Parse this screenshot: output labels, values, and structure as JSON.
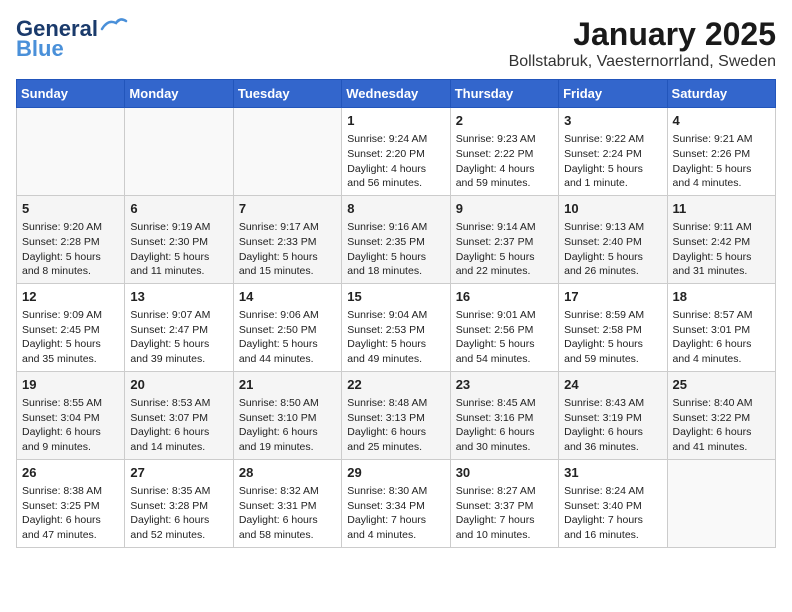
{
  "header": {
    "logo_line1": "General",
    "logo_line2": "Blue",
    "title": "January 2025",
    "subtitle": "Bollstabruk, Vaesternorrland, Sweden"
  },
  "days_of_week": [
    "Sunday",
    "Monday",
    "Tuesday",
    "Wednesday",
    "Thursday",
    "Friday",
    "Saturday"
  ],
  "weeks": [
    [
      {
        "day": "",
        "info": ""
      },
      {
        "day": "",
        "info": ""
      },
      {
        "day": "",
        "info": ""
      },
      {
        "day": "1",
        "info": "Sunrise: 9:24 AM\nSunset: 2:20 PM\nDaylight: 4 hours and 56 minutes."
      },
      {
        "day": "2",
        "info": "Sunrise: 9:23 AM\nSunset: 2:22 PM\nDaylight: 4 hours and 59 minutes."
      },
      {
        "day": "3",
        "info": "Sunrise: 9:22 AM\nSunset: 2:24 PM\nDaylight: 5 hours and 1 minute."
      },
      {
        "day": "4",
        "info": "Sunrise: 9:21 AM\nSunset: 2:26 PM\nDaylight: 5 hours and 4 minutes."
      }
    ],
    [
      {
        "day": "5",
        "info": "Sunrise: 9:20 AM\nSunset: 2:28 PM\nDaylight: 5 hours and 8 minutes."
      },
      {
        "day": "6",
        "info": "Sunrise: 9:19 AM\nSunset: 2:30 PM\nDaylight: 5 hours and 11 minutes."
      },
      {
        "day": "7",
        "info": "Sunrise: 9:17 AM\nSunset: 2:33 PM\nDaylight: 5 hours and 15 minutes."
      },
      {
        "day": "8",
        "info": "Sunrise: 9:16 AM\nSunset: 2:35 PM\nDaylight: 5 hours and 18 minutes."
      },
      {
        "day": "9",
        "info": "Sunrise: 9:14 AM\nSunset: 2:37 PM\nDaylight: 5 hours and 22 minutes."
      },
      {
        "day": "10",
        "info": "Sunrise: 9:13 AM\nSunset: 2:40 PM\nDaylight: 5 hours and 26 minutes."
      },
      {
        "day": "11",
        "info": "Sunrise: 9:11 AM\nSunset: 2:42 PM\nDaylight: 5 hours and 31 minutes."
      }
    ],
    [
      {
        "day": "12",
        "info": "Sunrise: 9:09 AM\nSunset: 2:45 PM\nDaylight: 5 hours and 35 minutes."
      },
      {
        "day": "13",
        "info": "Sunrise: 9:07 AM\nSunset: 2:47 PM\nDaylight: 5 hours and 39 minutes."
      },
      {
        "day": "14",
        "info": "Sunrise: 9:06 AM\nSunset: 2:50 PM\nDaylight: 5 hours and 44 minutes."
      },
      {
        "day": "15",
        "info": "Sunrise: 9:04 AM\nSunset: 2:53 PM\nDaylight: 5 hours and 49 minutes."
      },
      {
        "day": "16",
        "info": "Sunrise: 9:01 AM\nSunset: 2:56 PM\nDaylight: 5 hours and 54 minutes."
      },
      {
        "day": "17",
        "info": "Sunrise: 8:59 AM\nSunset: 2:58 PM\nDaylight: 5 hours and 59 minutes."
      },
      {
        "day": "18",
        "info": "Sunrise: 8:57 AM\nSunset: 3:01 PM\nDaylight: 6 hours and 4 minutes."
      }
    ],
    [
      {
        "day": "19",
        "info": "Sunrise: 8:55 AM\nSunset: 3:04 PM\nDaylight: 6 hours and 9 minutes."
      },
      {
        "day": "20",
        "info": "Sunrise: 8:53 AM\nSunset: 3:07 PM\nDaylight: 6 hours and 14 minutes."
      },
      {
        "day": "21",
        "info": "Sunrise: 8:50 AM\nSunset: 3:10 PM\nDaylight: 6 hours and 19 minutes."
      },
      {
        "day": "22",
        "info": "Sunrise: 8:48 AM\nSunset: 3:13 PM\nDaylight: 6 hours and 25 minutes."
      },
      {
        "day": "23",
        "info": "Sunrise: 8:45 AM\nSunset: 3:16 PM\nDaylight: 6 hours and 30 minutes."
      },
      {
        "day": "24",
        "info": "Sunrise: 8:43 AM\nSunset: 3:19 PM\nDaylight: 6 hours and 36 minutes."
      },
      {
        "day": "25",
        "info": "Sunrise: 8:40 AM\nSunset: 3:22 PM\nDaylight: 6 hours and 41 minutes."
      }
    ],
    [
      {
        "day": "26",
        "info": "Sunrise: 8:38 AM\nSunset: 3:25 PM\nDaylight: 6 hours and 47 minutes."
      },
      {
        "day": "27",
        "info": "Sunrise: 8:35 AM\nSunset: 3:28 PM\nDaylight: 6 hours and 52 minutes."
      },
      {
        "day": "28",
        "info": "Sunrise: 8:32 AM\nSunset: 3:31 PM\nDaylight: 6 hours and 58 minutes."
      },
      {
        "day": "29",
        "info": "Sunrise: 8:30 AM\nSunset: 3:34 PM\nDaylight: 7 hours and 4 minutes."
      },
      {
        "day": "30",
        "info": "Sunrise: 8:27 AM\nSunset: 3:37 PM\nDaylight: 7 hours and 10 minutes."
      },
      {
        "day": "31",
        "info": "Sunrise: 8:24 AM\nSunset: 3:40 PM\nDaylight: 7 hours and 16 minutes."
      },
      {
        "day": "",
        "info": ""
      }
    ]
  ]
}
